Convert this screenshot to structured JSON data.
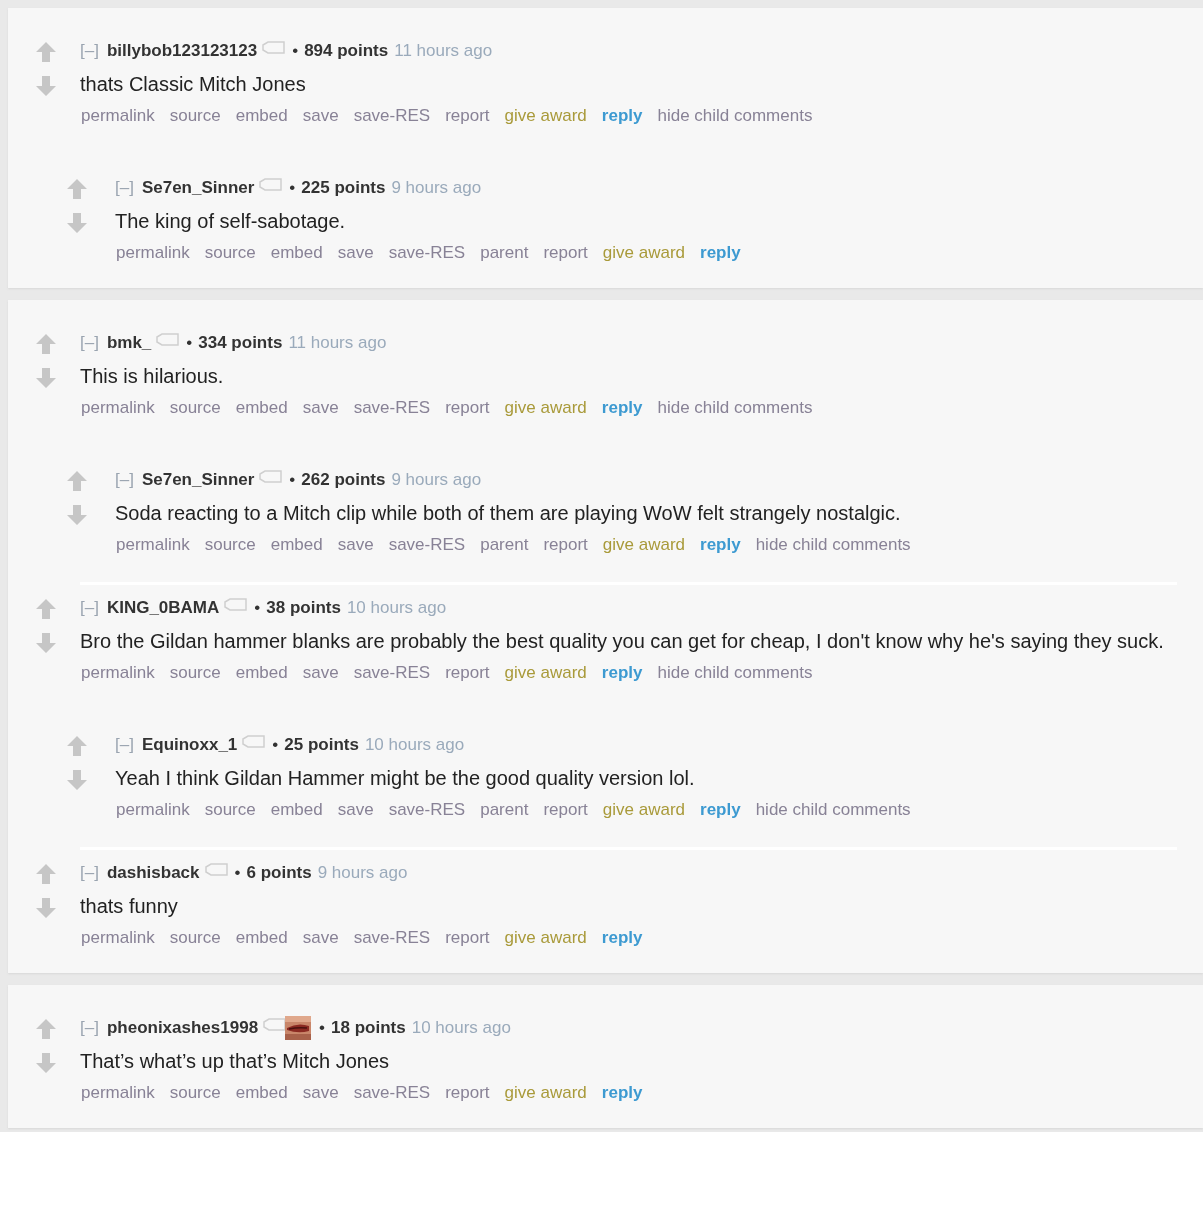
{
  "threads": [
    {
      "comments": [
        {
          "collapse": "[–]",
          "user": "billybob123123123",
          "bullet": "•",
          "points": "894 points",
          "time": "11 hours ago",
          "body": "thats Classic Mitch Jones",
          "actions": [
            {
              "kind": "link",
              "label": "permalink"
            },
            {
              "kind": "link",
              "label": "source"
            },
            {
              "kind": "link",
              "label": "embed"
            },
            {
              "kind": "link",
              "label": "save"
            },
            {
              "kind": "link",
              "label": "save-RES"
            },
            {
              "kind": "link",
              "label": "report"
            },
            {
              "kind": "award",
              "label": "give award"
            },
            {
              "kind": "reply",
              "label": "reply"
            },
            {
              "kind": "link",
              "label": "hide child comments"
            }
          ],
          "children": [
            {
              "collapse": "[–]",
              "user": "Se7en_Sinner",
              "bullet": "•",
              "points": "225 points",
              "time": "9 hours ago",
              "body": "The king of self-sabotage.",
              "actions": [
                {
                  "kind": "link",
                  "label": "permalink"
                },
                {
                  "kind": "link",
                  "label": "source"
                },
                {
                  "kind": "link",
                  "label": "embed"
                },
                {
                  "kind": "link",
                  "label": "save"
                },
                {
                  "kind": "link",
                  "label": "save-RES"
                },
                {
                  "kind": "link",
                  "label": "parent"
                },
                {
                  "kind": "link",
                  "label": "report"
                },
                {
                  "kind": "award",
                  "label": "give award"
                },
                {
                  "kind": "reply",
                  "label": "reply"
                }
              ]
            }
          ]
        }
      ]
    },
    {
      "comments": [
        {
          "collapse": "[–]",
          "user": "bmk_",
          "bullet": "•",
          "points": "334 points",
          "time": "11 hours ago",
          "body": "This is hilarious.",
          "actions": [
            {
              "kind": "link",
              "label": "permalink"
            },
            {
              "kind": "link",
              "label": "source"
            },
            {
              "kind": "link",
              "label": "embed"
            },
            {
              "kind": "link",
              "label": "save"
            },
            {
              "kind": "link",
              "label": "save-RES"
            },
            {
              "kind": "link",
              "label": "report"
            },
            {
              "kind": "award",
              "label": "give award"
            },
            {
              "kind": "reply",
              "label": "reply"
            },
            {
              "kind": "link",
              "label": "hide child comments"
            }
          ],
          "children": [
            {
              "collapse": "[–]",
              "user": "Se7en_Sinner",
              "bullet": "•",
              "points": "262 points",
              "time": "9 hours ago",
              "body": "Soda reacting to a Mitch clip while both of them are playing WoW felt strangely nostalgic.",
              "actions": [
                {
                  "kind": "link",
                  "label": "permalink"
                },
                {
                  "kind": "link",
                  "label": "source"
                },
                {
                  "kind": "link",
                  "label": "embed"
                },
                {
                  "kind": "link",
                  "label": "save"
                },
                {
                  "kind": "link",
                  "label": "save-RES"
                },
                {
                  "kind": "link",
                  "label": "parent"
                },
                {
                  "kind": "link",
                  "label": "report"
                },
                {
                  "kind": "award",
                  "label": "give award"
                },
                {
                  "kind": "reply",
                  "label": "reply"
                },
                {
                  "kind": "link",
                  "label": "hide child comments"
                }
              ]
            }
          ]
        },
        {
          "collapse": "[–]",
          "user": "KING_0BAMA",
          "bullet": "•",
          "points": "38 points",
          "time": "10 hours ago",
          "body": "Bro the Gildan hammer blanks are probably the best quality you can get for cheap, I don't know why he's saying they suck.",
          "actions": [
            {
              "kind": "link",
              "label": "permalink"
            },
            {
              "kind": "link",
              "label": "source"
            },
            {
              "kind": "link",
              "label": "embed"
            },
            {
              "kind": "link",
              "label": "save"
            },
            {
              "kind": "link",
              "label": "save-RES"
            },
            {
              "kind": "link",
              "label": "report"
            },
            {
              "kind": "award",
              "label": "give award"
            },
            {
              "kind": "reply",
              "label": "reply"
            },
            {
              "kind": "link",
              "label": "hide child comments"
            }
          ],
          "children": [
            {
              "collapse": "[–]",
              "user": "Equinoxx_1",
              "bullet": "•",
              "points": "25 points",
              "time": "10 hours ago",
              "body": "Yeah I think Gildan Hammer might be the good quality version lol.",
              "actions": [
                {
                  "kind": "link",
                  "label": "permalink"
                },
                {
                  "kind": "link",
                  "label": "source"
                },
                {
                  "kind": "link",
                  "label": "embed"
                },
                {
                  "kind": "link",
                  "label": "save"
                },
                {
                  "kind": "link",
                  "label": "save-RES"
                },
                {
                  "kind": "link",
                  "label": "parent"
                },
                {
                  "kind": "link",
                  "label": "report"
                },
                {
                  "kind": "award",
                  "label": "give award"
                },
                {
                  "kind": "reply",
                  "label": "reply"
                },
                {
                  "kind": "link",
                  "label": "hide child comments"
                }
              ]
            }
          ]
        },
        {
          "collapse": "[–]",
          "user": "dashisback",
          "bullet": "•",
          "points": "6 points",
          "time": "9 hours ago",
          "body": "thats funny",
          "actions": [
            {
              "kind": "link",
              "label": "permalink"
            },
            {
              "kind": "link",
              "label": "source"
            },
            {
              "kind": "link",
              "label": "embed"
            },
            {
              "kind": "link",
              "label": "save"
            },
            {
              "kind": "link",
              "label": "save-RES"
            },
            {
              "kind": "link",
              "label": "report"
            },
            {
              "kind": "award",
              "label": "give award"
            },
            {
              "kind": "reply",
              "label": "reply"
            }
          ]
        }
      ]
    },
    {
      "comments": [
        {
          "collapse": "[–]",
          "user": "pheonixashes1998",
          "flair": {
            "kind": "picture"
          },
          "bullet": "•",
          "points": "18 points",
          "time": "10 hours ago",
          "body": "That’s what’s up that’s Mitch Jones",
          "actions": [
            {
              "kind": "link",
              "label": "permalink"
            },
            {
              "kind": "link",
              "label": "source"
            },
            {
              "kind": "link",
              "label": "embed"
            },
            {
              "kind": "link",
              "label": "save"
            },
            {
              "kind": "link",
              "label": "save-RES"
            },
            {
              "kind": "link",
              "label": "report"
            },
            {
              "kind": "award",
              "label": "give award"
            },
            {
              "kind": "reply",
              "label": "reply"
            }
          ]
        }
      ]
    }
  ]
}
